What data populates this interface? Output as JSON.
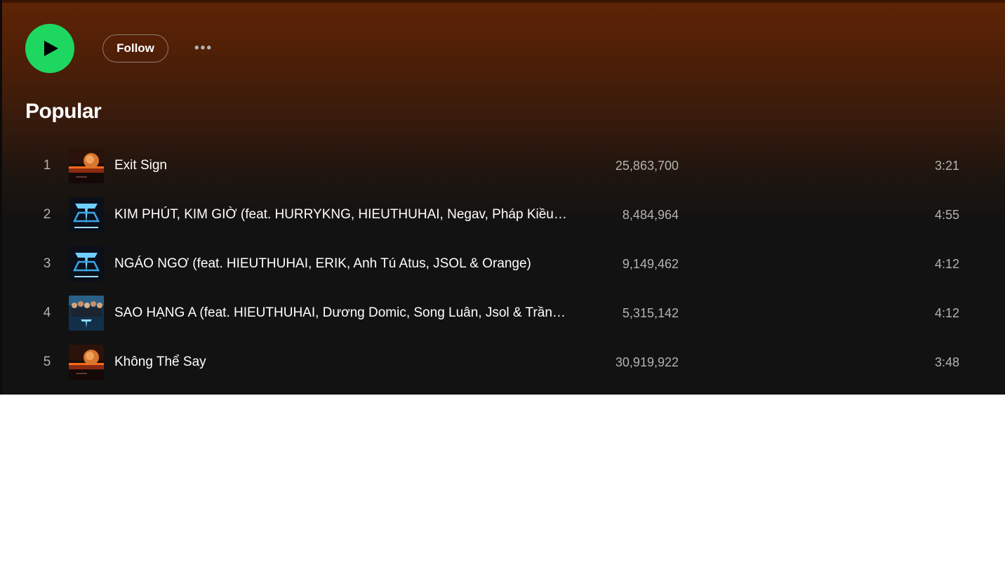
{
  "actions": {
    "play_label": "Play",
    "follow_label": "Follow",
    "more_label": "More options"
  },
  "section": {
    "title": "Popular"
  },
  "tracks": [
    {
      "rank": "1",
      "title": "Exit Sign",
      "plays": "25,863,700",
      "duration": "3:21",
      "art": "sunset-album-art"
    },
    {
      "rank": "2",
      "title": "KIM PHÚT, KIM GIỜ (feat. HURRYKNG, HIEUTHUHAI, Negav, Pháp Kiều …",
      "plays": "8,484,964",
      "duration": "4:55",
      "art": "anh-trai-say-hi-art"
    },
    {
      "rank": "3",
      "title": "NGÁO NGƠ (feat. HIEUTHUHAI, ERIK, Anh Tú Atus, JSOL & Orange)",
      "plays": "9,149,462",
      "duration": "4:12",
      "art": "anh-trai-say-hi-art"
    },
    {
      "rank": "4",
      "title": "SAO HẠNG A (feat. HIEUTHUHAI, Dương Domic, Song Luân, Jsol & Trần…",
      "plays": "5,315,142",
      "duration": "4:12",
      "art": "group-photo-art"
    },
    {
      "rank": "5",
      "title": "Không Thể Say",
      "plays": "30,919,922",
      "duration": "3:48",
      "art": "sunset-album-art"
    }
  ],
  "colors": {
    "accent": "#1ed760",
    "header_gradient_top": "#5e2405",
    "background": "#121212",
    "text_primary": "#ffffff",
    "text_secondary": "#b3b3b3"
  }
}
